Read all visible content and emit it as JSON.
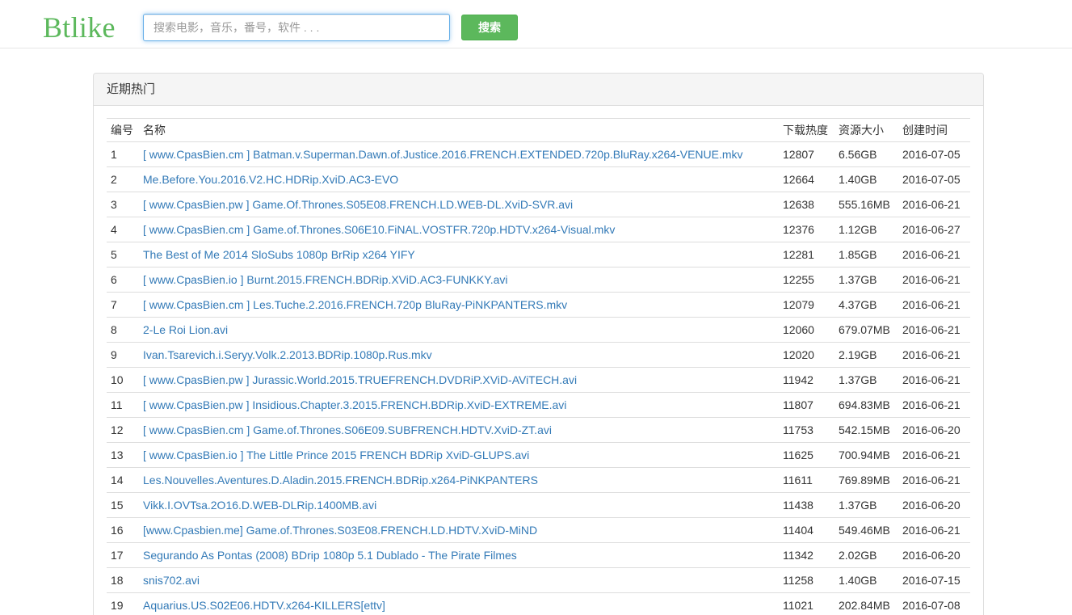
{
  "header": {
    "logo": "Btlike",
    "search_placeholder": "搜索电影，音乐，番号，软件 . . .",
    "search_button": "搜索"
  },
  "panel": {
    "title": "近期热门",
    "columns": [
      "编号",
      "名称",
      "下载热度",
      "资源大小",
      "创建时间"
    ],
    "rows": [
      {
        "idx": "1",
        "name": "[ www.CpasBien.cm ] Batman.v.Superman.Dawn.of.Justice.2016.FRENCH.EXTENDED.720p.BluRay.x264-VENUE.mkv",
        "hot": "12807",
        "size": "6.56GB",
        "date": "2016-07-05"
      },
      {
        "idx": "2",
        "name": "Me.Before.You.2016.V2.HC.HDRip.XviD.AC3-EVO",
        "hot": "12664",
        "size": "1.40GB",
        "date": "2016-07-05"
      },
      {
        "idx": "3",
        "name": "[ www.CpasBien.pw ] Game.Of.Thrones.S05E08.FRENCH.LD.WEB-DL.XviD-SVR.avi",
        "hot": "12638",
        "size": "555.16MB",
        "date": "2016-06-21"
      },
      {
        "idx": "4",
        "name": "[ www.CpasBien.cm ] Game.of.Thrones.S06E10.FiNAL.VOSTFR.720p.HDTV.x264-Visual.mkv",
        "hot": "12376",
        "size": "1.12GB",
        "date": "2016-06-27"
      },
      {
        "idx": "5",
        "name": "The Best of Me 2014 SloSubs 1080p BrRip x264 YIFY",
        "hot": "12281",
        "size": "1.85GB",
        "date": "2016-06-21"
      },
      {
        "idx": "6",
        "name": "[ www.CpasBien.io ] Burnt.2015.FRENCH.BDRip.XViD.AC3-FUNKKY.avi",
        "hot": "12255",
        "size": "1.37GB",
        "date": "2016-06-21"
      },
      {
        "idx": "7",
        "name": "[ www.CpasBien.cm ] Les.Tuche.2.2016.FRENCH.720p BluRay-PiNKPANTERS.mkv",
        "hot": "12079",
        "size": "4.37GB",
        "date": "2016-06-21"
      },
      {
        "idx": "8",
        "name": "2-Le Roi Lion.avi",
        "hot": "12060",
        "size": "679.07MB",
        "date": "2016-06-21"
      },
      {
        "idx": "9",
        "name": "Ivan.Tsarevich.i.Seryy.Volk.2.2013.BDRip.1080p.Rus.mkv",
        "hot": "12020",
        "size": "2.19GB",
        "date": "2016-06-21"
      },
      {
        "idx": "10",
        "name": "[ www.CpasBien.pw ] Jurassic.World.2015.TRUEFRENCH.DVDRiP.XViD-AViTECH.avi",
        "hot": "11942",
        "size": "1.37GB",
        "date": "2016-06-21"
      },
      {
        "idx": "11",
        "name": "[ www.CpasBien.pw ] Insidious.Chapter.3.2015.FRENCH.BDRip.XviD-EXTREME.avi",
        "hot": "11807",
        "size": "694.83MB",
        "date": "2016-06-21"
      },
      {
        "idx": "12",
        "name": "[ www.CpasBien.cm ] Game.of.Thrones.S06E09.SUBFRENCH.HDTV.XviD-ZT.avi",
        "hot": "11753",
        "size": "542.15MB",
        "date": "2016-06-20"
      },
      {
        "idx": "13",
        "name": "[ www.CpasBien.io ] The Little Prince 2015 FRENCH BDRip XviD-GLUPS.avi",
        "hot": "11625",
        "size": "700.94MB",
        "date": "2016-06-21"
      },
      {
        "idx": "14",
        "name": "Les.Nouvelles.Aventures.D.Aladin.2015.FRENCH.BDRip.x264-PiNKPANTERS",
        "hot": "11611",
        "size": "769.89MB",
        "date": "2016-06-21"
      },
      {
        "idx": "15",
        "name": "Vikk.I.OVTsa.2O16.D.WEB-DLRip.1400MB.avi",
        "hot": "11438",
        "size": "1.37GB",
        "date": "2016-06-20"
      },
      {
        "idx": "16",
        "name": "[www.Cpasbien.me] Game.of.Thrones.S03E08.FRENCH.LD.HDTV.XviD-MiND",
        "hot": "11404",
        "size": "549.46MB",
        "date": "2016-06-21"
      },
      {
        "idx": "17",
        "name": "Segurando As Pontas (2008) BDrip 1080p 5.1 Dublado - The Pirate Filmes",
        "hot": "11342",
        "size": "2.02GB",
        "date": "2016-06-20"
      },
      {
        "idx": "18",
        "name": "snis702.avi",
        "hot": "11258",
        "size": "1.40GB",
        "date": "2016-07-15"
      },
      {
        "idx": "19",
        "name": "Aquarius.US.S02E06.HDTV.x264-KILLERS[ettv]",
        "hot": "11021",
        "size": "202.84MB",
        "date": "2016-07-08"
      }
    ]
  }
}
